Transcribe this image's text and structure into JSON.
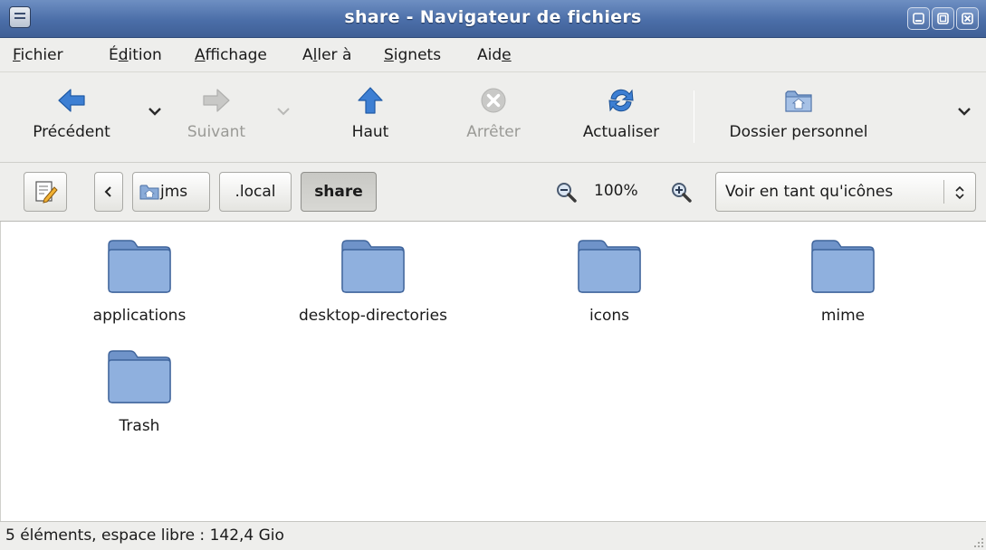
{
  "window": {
    "title": "share - Navigateur de fichiers"
  },
  "menubar": {
    "items": [
      {
        "pre": "",
        "u": "F",
        "post": "ichier"
      },
      {
        "pre": "É",
        "u": "d",
        "post": "ition"
      },
      {
        "pre": "",
        "u": "A",
        "post": "ffichage"
      },
      {
        "pre": "A",
        "u": "l",
        "post": "ler à"
      },
      {
        "pre": "",
        "u": "S",
        "post": "ignets"
      },
      {
        "pre": "Aid",
        "u": "e",
        "post": ""
      }
    ]
  },
  "toolbar": {
    "back_label": "Précédent",
    "forward_label": "Suivant",
    "up_label": "Haut",
    "stop_label": "Arrêter",
    "reload_label": "Actualiser",
    "home_label": "Dossier personnel"
  },
  "location": {
    "crumbs": [
      "jms",
      ".local",
      "share"
    ],
    "zoom": "100%",
    "view_mode": "Voir en tant qu'icônes"
  },
  "files": [
    {
      "name": "applications"
    },
    {
      "name": "desktop-directories"
    },
    {
      "name": "icons"
    },
    {
      "name": "mime"
    },
    {
      "name": "Trash"
    }
  ],
  "status": {
    "text": "5 éléments, espace libre : 142,4 Gio"
  },
  "colors": {
    "titlebar": "#4b6ea8",
    "folder": "#7fa1d4",
    "folder_border": "#4a6fa5",
    "arrow_blue": "#3d7fd3"
  }
}
